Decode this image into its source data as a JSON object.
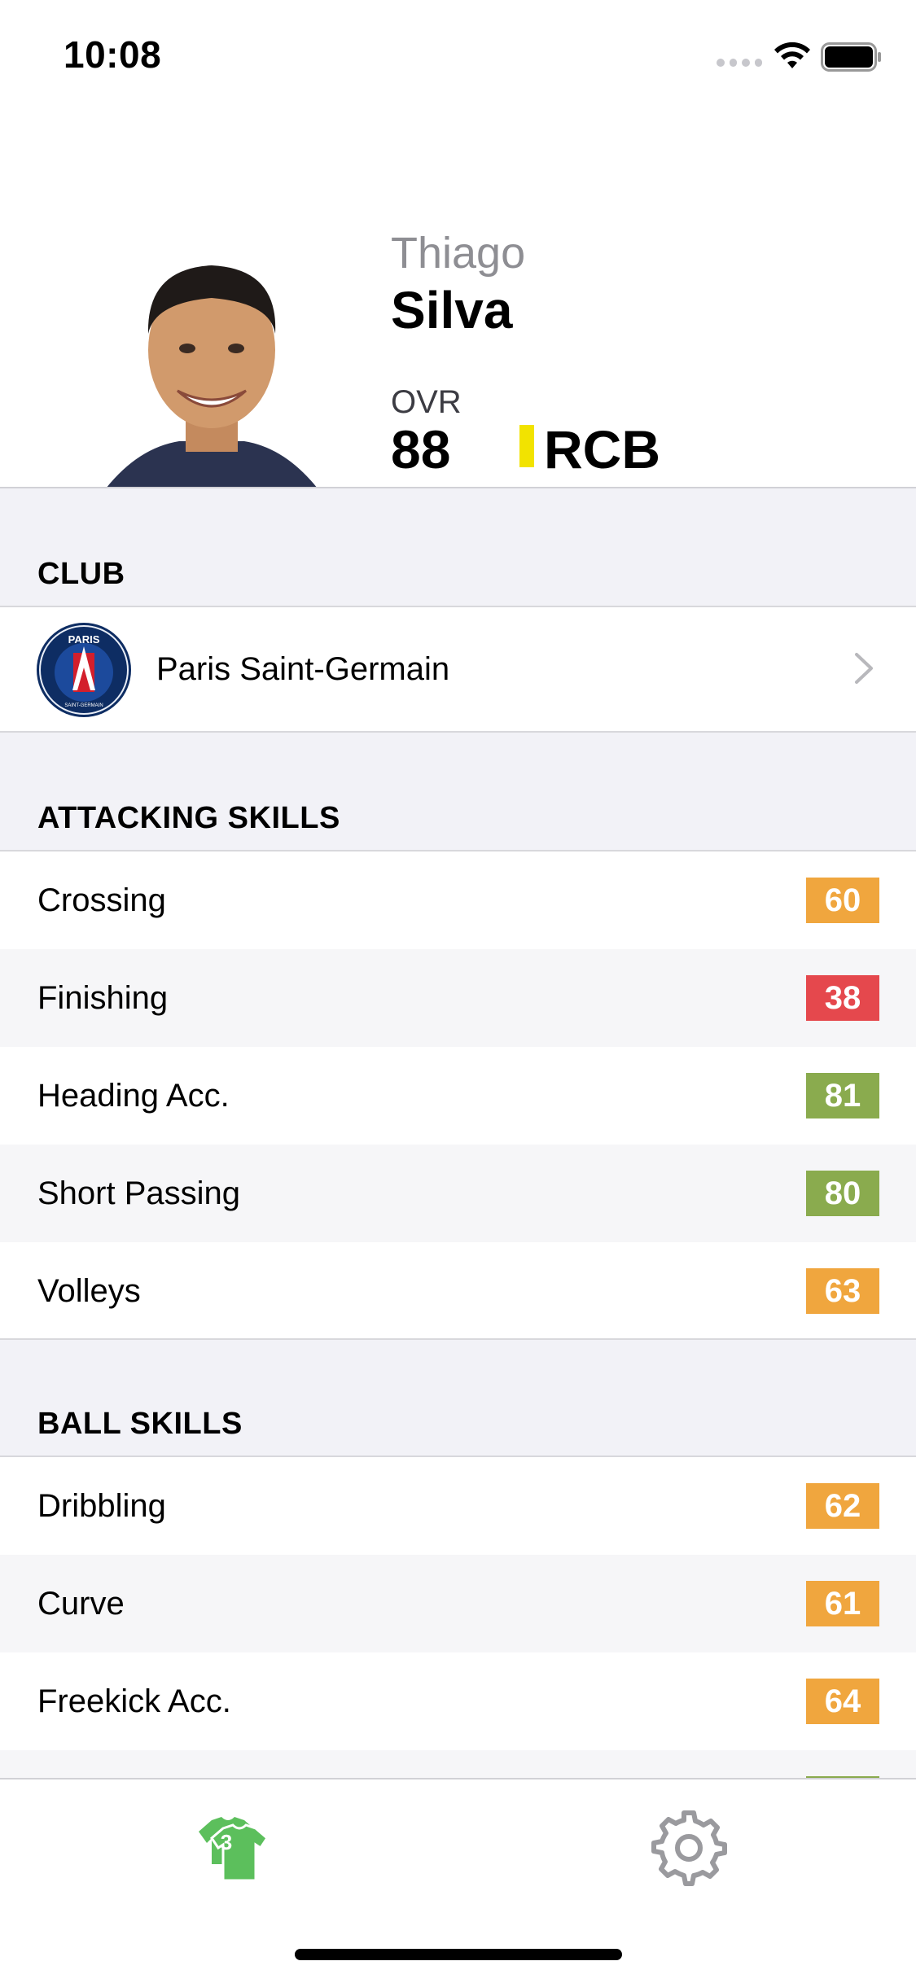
{
  "status_bar": {
    "time": "10:08"
  },
  "player": {
    "first_name": "Thiago",
    "last_name": "Silva",
    "ovr_label": "OVR",
    "ovr": "88",
    "position": "RCB",
    "position_color": "#f2e300"
  },
  "club_section": {
    "title": "CLUB",
    "club_name": "Paris Saint-Germain",
    "logo_text_top": "PARIS",
    "logo_text_bottom": "SAINT-GERMAIN"
  },
  "attacking": {
    "title": "ATTACKING SKILLS",
    "skills": [
      {
        "name": "Crossing",
        "value": "60",
        "color": "#f0a63e"
      },
      {
        "name": "Finishing",
        "value": "38",
        "color": "#e5484d"
      },
      {
        "name": "Heading Acc.",
        "value": "81",
        "color": "#8aab4e"
      },
      {
        "name": "Short Passing",
        "value": "80",
        "color": "#8aab4e"
      },
      {
        "name": "Volleys",
        "value": "63",
        "color": "#f0a63e"
      }
    ]
  },
  "ball": {
    "title": "BALL SKILLS",
    "skills": [
      {
        "name": "Dribbling",
        "value": "62",
        "color": "#f0a63e"
      },
      {
        "name": "Curve",
        "value": "61",
        "color": "#f0a63e"
      },
      {
        "name": "Freekick Acc.",
        "value": "64",
        "color": "#f0a63e"
      }
    ]
  },
  "tab_bar": {
    "squad_badge": "3",
    "active_color": "#5cbf5c"
  },
  "icons": {
    "back": "chevron-left-icon",
    "chevron": "chevron-right-icon",
    "squad": "jersey-icon",
    "settings": "gear-icon"
  }
}
